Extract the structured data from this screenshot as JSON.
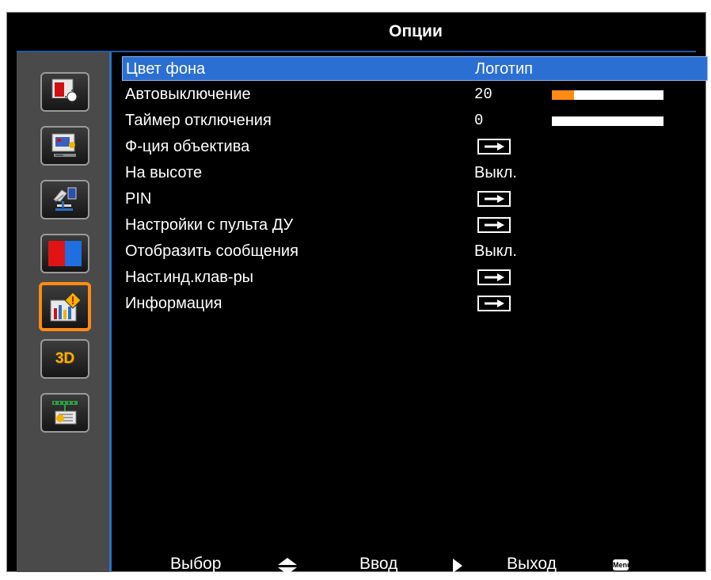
{
  "window": {
    "title": "Опции"
  },
  "sidebar": {
    "items": [
      {
        "icon": "display-settings-icon"
      },
      {
        "icon": "screen-settings-icon"
      },
      {
        "icon": "remote-settings-icon"
      },
      {
        "icon": "color-settings-icon"
      },
      {
        "icon": "options-info-icon",
        "active": true
      },
      {
        "icon": "3d-icon",
        "label": "3D"
      },
      {
        "icon": "network-icon"
      }
    ]
  },
  "menu": {
    "items": [
      {
        "label": "Цвет фона",
        "value": "Логотип",
        "selected": true
      },
      {
        "label": "Автовыключение",
        "value": "20",
        "level": 0.2
      },
      {
        "label": "Таймер отключения",
        "value": "0",
        "level": 0.0
      },
      {
        "label": "Ф-ция объектива",
        "submenu": true
      },
      {
        "label": "На высоте",
        "value": "Выкл."
      },
      {
        "label": "PIN",
        "submenu": true
      },
      {
        "label": "Настройки с пульта ДУ",
        "submenu": true
      },
      {
        "label": "Отобразить сообщения",
        "value": "Выкл."
      },
      {
        "label": "Наст.инд.клав-ры",
        "submenu": true
      },
      {
        "label": "Информация",
        "submenu": true
      }
    ]
  },
  "footer": {
    "select_label": "Выбор",
    "enter_label": "Ввод",
    "exit_label": "Выход",
    "menu_key_label": "Menu"
  },
  "colors": {
    "accent": "#ff8a14",
    "selection": "#2b6fd3",
    "sidebar_border": "#2a70c8"
  }
}
